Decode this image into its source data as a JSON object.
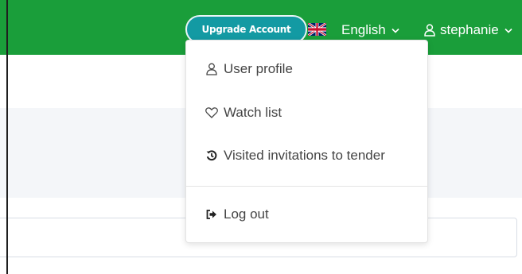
{
  "header": {
    "upgrade_label": "Upgrade Account",
    "language_label": "English",
    "username": "stephanie"
  },
  "user_menu": {
    "items": [
      {
        "label": "User profile",
        "icon": "user-icon"
      },
      {
        "label": "Watch list",
        "icon": "heart-icon"
      },
      {
        "label": "Visited invitations to tender",
        "icon": "history-icon"
      },
      {
        "label": "Log out",
        "icon": "logout-icon"
      }
    ]
  },
  "colors": {
    "header_green": "#1a9e3a",
    "upgrade_teal": "#139aa3"
  }
}
